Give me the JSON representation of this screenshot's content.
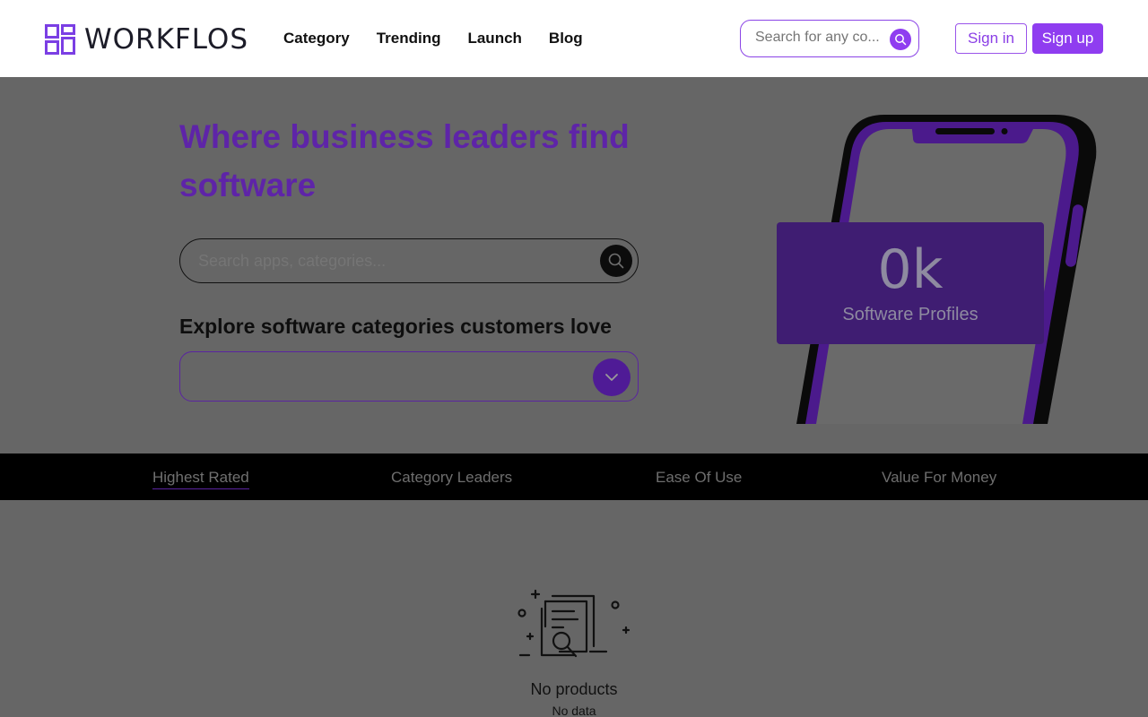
{
  "brand": {
    "name": "WORKFLOS",
    "accent": "#8f3df0",
    "dark_accent": "#5e24a8"
  },
  "nav": {
    "items": [
      "Category",
      "Trending",
      "Launch",
      "Blog"
    ]
  },
  "header": {
    "search_placeholder": "Search for any co...",
    "sign_in": "Sign in",
    "sign_up": "Sign up"
  },
  "hero": {
    "title": "Where business leaders find software",
    "search_placeholder": "Search apps, categories...",
    "explore_heading": "Explore software categories customers love",
    "category_select_value": ""
  },
  "stat": {
    "value": "0k",
    "label": "Software Profiles"
  },
  "tabs": [
    "Highest Rated",
    "Category Leaders",
    "Ease Of Use",
    "Value For Money"
  ],
  "active_tab": "Highest Rated",
  "empty_state": {
    "title": "No products",
    "subtitle": "No data",
    "icon": "documents-search-icon"
  },
  "icons": [
    "logo-mark-icon",
    "search-icon",
    "chevron-down-icon"
  ]
}
